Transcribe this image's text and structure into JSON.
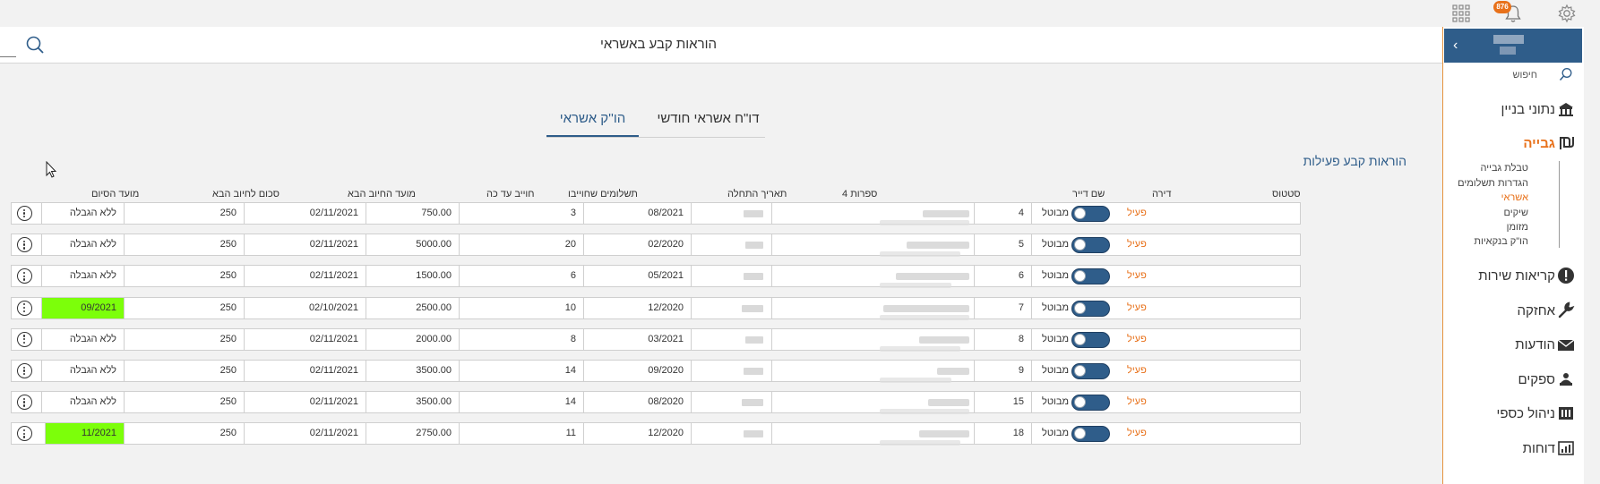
{
  "topbar": {
    "icons": [
      "apps-grid-icon",
      "bell-icon",
      "gear-icon"
    ],
    "notification_count": "876"
  },
  "header": {
    "title": "הוראות קבע באשראי",
    "search_icon": "search-icon"
  },
  "sidebar": {
    "search_placeholder": "חיפוש",
    "items": [
      {
        "label": "נתוני בניין",
        "icon": "building-icon"
      },
      {
        "label": "גבייה",
        "icon": "shekel-icon",
        "active": true
      },
      {
        "label": "קריאות שירות",
        "icon": "alert-icon"
      },
      {
        "label": "אחזקה",
        "icon": "wrench-icon"
      },
      {
        "label": "הודעות",
        "icon": "envelope-icon"
      },
      {
        "label": "ספקים",
        "icon": "supplier-icon"
      },
      {
        "label": "ניהול כספי",
        "icon": "cash-register-icon"
      },
      {
        "label": "דוחות",
        "icon": "report-icon"
      }
    ],
    "subitems": [
      {
        "label": "טבלת גבייה"
      },
      {
        "label": "הגדרות תשלומים"
      },
      {
        "label": "אשראי",
        "active": true
      },
      {
        "label": "שיקים"
      },
      {
        "label": "מזומן"
      },
      {
        "label": "הו\"ק בנקאיות"
      }
    ]
  },
  "tabs": [
    {
      "label": "דו\"ח אשראי חודשי",
      "active": false
    },
    {
      "label": "הו''ק אשראי",
      "active": true
    }
  ],
  "section_title": "הוראות קבע פעילות",
  "table": {
    "columns": {
      "status": "סטטוס",
      "apartment": "דירה",
      "tenant": "שם דייר",
      "digits4": "4 ספרות",
      "start_date": "תאריך התחלה",
      "payments": "תשלומים שחוייבו",
      "charged": "חוייב עד כה",
      "next_date": "מועד החיוב הבא",
      "next_amount": "סכום לחיוב הבא",
      "end_date": "מועד הסיום"
    },
    "status_active": "פעיל",
    "status_off": "מבוטל",
    "rows": [
      {
        "apartment": "4",
        "start": "08/2021",
        "payments": "3",
        "charged": "750.00",
        "next_date": "02/11/2021",
        "next_amount": "250",
        "end": "ללא הגבלה",
        "end_highlight": false
      },
      {
        "apartment": "5",
        "start": "02/2020",
        "payments": "20",
        "charged": "5000.00",
        "next_date": "02/11/2021",
        "next_amount": "250",
        "end": "ללא הגבלה",
        "end_highlight": false
      },
      {
        "apartment": "6",
        "start": "05/2021",
        "payments": "6",
        "charged": "1500.00",
        "next_date": "02/11/2021",
        "next_amount": "250",
        "end": "ללא הגבלה",
        "end_highlight": false
      },
      {
        "apartment": "7",
        "start": "12/2020",
        "payments": "10",
        "charged": "2500.00",
        "next_date": "02/10/2021",
        "next_amount": "250",
        "end": "09/2021",
        "end_highlight": true
      },
      {
        "apartment": "8",
        "start": "03/2021",
        "payments": "8",
        "charged": "2000.00",
        "next_date": "02/11/2021",
        "next_amount": "250",
        "end": "ללא הגבלה",
        "end_highlight": false
      },
      {
        "apartment": "9",
        "start": "09/2020",
        "payments": "14",
        "charged": "3500.00",
        "next_date": "02/11/2021",
        "next_amount": "250",
        "end": "ללא הגבלה",
        "end_highlight": false
      },
      {
        "apartment": "15",
        "start": "08/2020",
        "payments": "14",
        "charged": "3500.00",
        "next_date": "02/11/2021",
        "next_amount": "250",
        "end": "ללא הגבלה",
        "end_highlight": false
      },
      {
        "apartment": "18",
        "start": "12/2020",
        "payments": "11",
        "charged": "2750.00",
        "next_date": "02/11/2021",
        "next_amount": "250",
        "end": "11/2021",
        "end_highlight": true
      }
    ]
  },
  "colors": {
    "accent": "#2f5d8a",
    "orange": "#e8711a",
    "highlight_green": "#7cff0a"
  }
}
